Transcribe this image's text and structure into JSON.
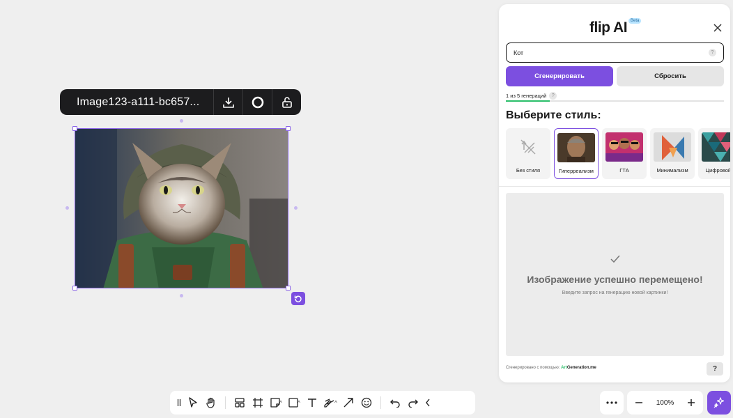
{
  "canvas": {
    "image_toolbar": {
      "filename": "Image123-a111-bc657...",
      "download_icon": "download-icon",
      "circle_icon": "circle-icon",
      "unlock_icon": "unlock-icon"
    },
    "image": {
      "description_icon": "cat-in-hoodie-image"
    }
  },
  "panel": {
    "logo": "flip AI",
    "beta": "Beta",
    "prompt_value": "Кот",
    "generate_label": "Сгенерировать",
    "reset_label": "Сбросить",
    "counter": "1 из 5 генераций",
    "progress_fraction": 0.2,
    "style_heading": "Выберите стиль:",
    "styles": [
      {
        "label": "Без стиля",
        "active": false
      },
      {
        "label": "Гиперреализм",
        "active": true
      },
      {
        "label": "ГТА",
        "active": false
      },
      {
        "label": "Минимализм",
        "active": false
      },
      {
        "label": "Цифровой а",
        "active": false
      }
    ],
    "result_title": "Изображение успешно перемещено!",
    "result_subtitle": "Введите запрос на генерацию новой картинки!",
    "footer_prefix": "Сгенерировано с помощью:",
    "footer_brand_1": "Art",
    "footer_brand_2": "Generation.me",
    "help_label": "?"
  },
  "bottom_bar": {
    "zoom": "100%"
  },
  "colors": {
    "accent": "#7c4fe0",
    "progress": "#2bbf6a",
    "canvas_bg": "#efefef"
  }
}
